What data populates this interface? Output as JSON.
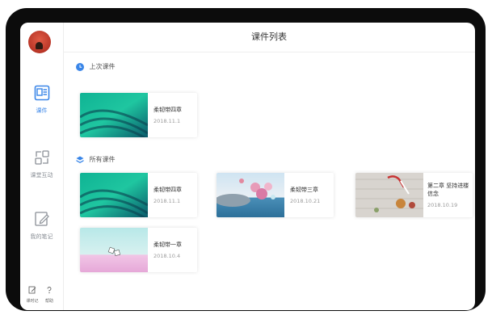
{
  "header": {
    "title": "课件列表"
  },
  "sidebar": {
    "items": [
      {
        "label": "课件",
        "icon": "ppt-document-icon",
        "active": true
      },
      {
        "label": "课堂互动",
        "icon": "interaction-icon",
        "active": false
      },
      {
        "label": "我的笔记",
        "icon": "note-edit-icon",
        "active": false
      }
    ],
    "bottom": [
      {
        "label": "课时记",
        "icon": "edit-icon"
      },
      {
        "label": "帮助",
        "icon": "help-icon"
      }
    ]
  },
  "sections": {
    "last": {
      "title": "上次课件",
      "icon": "clock-icon"
    },
    "all": {
      "title": "所有课件",
      "icon": "layers-icon"
    }
  },
  "last_course": {
    "title": "柔韧带四章",
    "date": "2018.11.1"
  },
  "courses": [
    {
      "title": "柔韧带四章",
      "date": "2018.11.1"
    },
    {
      "title": "柔韧带三章",
      "date": "2018.10.21"
    },
    {
      "title": "第二章 坚持进楼信念",
      "date": "2018.10.19"
    },
    {
      "title": "柔韧带一章",
      "date": "2018.10.4"
    }
  ],
  "colors": {
    "accent": "#3a86e8",
    "device": "#0c0c0c"
  }
}
